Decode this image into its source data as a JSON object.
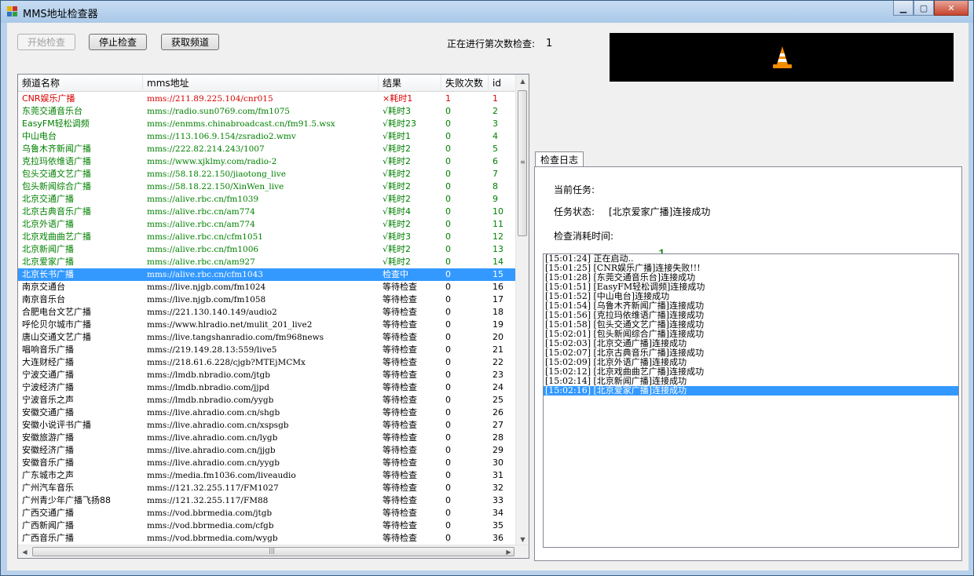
{
  "window": {
    "title": "MMS地址检查器"
  },
  "toolbar": {
    "start_label": "开始检查",
    "stop_label": "停止检查",
    "fetch_label": "获取频道",
    "count_label": "正在进行第次数检查:",
    "count_value": "1"
  },
  "colors": {
    "fail": "#d80000",
    "ok": "#008000",
    "selected": "#3399ff"
  },
  "list": {
    "columns": [
      "频道名称",
      "mms地址",
      "结果",
      "失败次数",
      "id"
    ],
    "rows": [
      {
        "name": "CNR娱乐广播",
        "url": "mms://211.89.225.104/cnr015",
        "result": "×耗时1",
        "fails": "1",
        "id": "1",
        "status": "fail"
      },
      {
        "name": "东莞交通音乐台",
        "url": "mms://radio.sun0769.com/fm1075",
        "result": "√耗时3",
        "fails": "0",
        "id": "2",
        "status": "ok"
      },
      {
        "name": "EasyFM轻松调频",
        "url": "mms://enmms.chinabroadcast.cn/fm91.5.wsx",
        "result": "√耗时23",
        "fails": "0",
        "id": "3",
        "status": "ok"
      },
      {
        "name": "中山电台",
        "url": "mms://113.106.9.154/zsradio2.wmv",
        "result": "√耗时1",
        "fails": "0",
        "id": "4",
        "status": "ok"
      },
      {
        "name": "乌鲁木齐新闻广播",
        "url": "mms://222.82.214.243/1007",
        "result": "√耗时2",
        "fails": "0",
        "id": "5",
        "status": "ok"
      },
      {
        "name": "克拉玛依维语广播",
        "url": "mms://www.xjklmy.com/radio-2",
        "result": "√耗时2",
        "fails": "0",
        "id": "6",
        "status": "ok"
      },
      {
        "name": "包头交通文艺广播",
        "url": "mms://58.18.22.150/jiaotong_live",
        "result": "√耗时2",
        "fails": "0",
        "id": "7",
        "status": "ok"
      },
      {
        "name": "包头新闻综合广播",
        "url": "mms://58.18.22.150/XinWen_live",
        "result": "√耗时2",
        "fails": "0",
        "id": "8",
        "status": "ok"
      },
      {
        "name": "北京交通广播",
        "url": "mms://alive.rbc.cn/fm1039",
        "result": "√耗时2",
        "fails": "0",
        "id": "9",
        "status": "ok"
      },
      {
        "name": "北京古典音乐广播",
        "url": "mms://alive.rbc.cn/am774",
        "result": "√耗时4",
        "fails": "0",
        "id": "10",
        "status": "ok"
      },
      {
        "name": "北京外语广播",
        "url": "mms://alive.rbc.cn/am774",
        "result": "√耗时2",
        "fails": "0",
        "id": "11",
        "status": "ok"
      },
      {
        "name": "北京戏曲曲艺广播",
        "url": "mms://alive.rbc.cn/cfm1051",
        "result": "√耗时3",
        "fails": "0",
        "id": "12",
        "status": "ok"
      },
      {
        "name": "北京新闻广播",
        "url": "mms://alive.rbc.cn/fm1006",
        "result": "√耗时2",
        "fails": "0",
        "id": "13",
        "status": "ok"
      },
      {
        "name": "北京爱家广播",
        "url": "mms://alive.rbc.cn/am927",
        "result": "√耗时2",
        "fails": "0",
        "id": "14",
        "status": "ok"
      },
      {
        "name": "北京长书广播",
        "url": "mms://alive.rbc.cn/cfm1043",
        "result": "检查中",
        "fails": "0",
        "id": "15",
        "status": "sel"
      },
      {
        "name": "南京交通台",
        "url": "mms://live.njgb.com/fm1024",
        "result": "等待检查",
        "fails": "0",
        "id": "16",
        "status": ""
      },
      {
        "name": "南京音乐台",
        "url": "mms://live.njgb.com/fm1058",
        "result": "等待检查",
        "fails": "0",
        "id": "17",
        "status": ""
      },
      {
        "name": "合肥电台文艺广播",
        "url": "mms://221.130.140.149/audio2",
        "result": "等待检查",
        "fails": "0",
        "id": "18",
        "status": ""
      },
      {
        "name": "呼伦贝尔城市广播",
        "url": "mms://www.hlradio.net/mulit_201_live2",
        "result": "等待检查",
        "fails": "0",
        "id": "19",
        "status": ""
      },
      {
        "name": "唐山交通文艺广播",
        "url": "mms://live.tangshanradio.com/fm968news",
        "result": "等待检查",
        "fails": "0",
        "id": "20",
        "status": ""
      },
      {
        "name": "唱响音乐广播",
        "url": "mms://219.149.28.13:559/live5",
        "result": "等待检查",
        "fails": "0",
        "id": "21",
        "status": ""
      },
      {
        "name": "大连财经广播",
        "url": "mms://218.61.6.228/cjgb?MTEjMCMx",
        "result": "等待检查",
        "fails": "0",
        "id": "22",
        "status": ""
      },
      {
        "name": "宁波交通广播",
        "url": "mms://lmdb.nbradio.com/jtgb",
        "result": "等待检查",
        "fails": "0",
        "id": "23",
        "status": ""
      },
      {
        "name": "宁波经济广播",
        "url": "mms://lmdb.nbradio.com/jjpd",
        "result": "等待检查",
        "fails": "0",
        "id": "24",
        "status": ""
      },
      {
        "name": "宁波音乐之声",
        "url": "mms://lmdb.nbradio.com/yygb",
        "result": "等待检查",
        "fails": "0",
        "id": "25",
        "status": ""
      },
      {
        "name": "安徽交通广播",
        "url": "mms://live.ahradio.com.cn/shgb",
        "result": "等待检查",
        "fails": "0",
        "id": "26",
        "status": ""
      },
      {
        "name": "安徽小说评书广播",
        "url": "mms://live.ahradio.com.cn/xspsgb",
        "result": "等待检查",
        "fails": "0",
        "id": "27",
        "status": ""
      },
      {
        "name": "安徽旅游广播",
        "url": "mms://live.ahradio.com.cn/lygb",
        "result": "等待检查",
        "fails": "0",
        "id": "28",
        "status": ""
      },
      {
        "name": "安徽经济广播",
        "url": "mms://live.ahradio.com.cn/jjgb",
        "result": "等待检查",
        "fails": "0",
        "id": "29",
        "status": ""
      },
      {
        "name": "安徽音乐广播",
        "url": "mms://live.ahradio.com.cn/yygb",
        "result": "等待检查",
        "fails": "0",
        "id": "30",
        "status": ""
      },
      {
        "name": "广东城市之声",
        "url": "mms://media.fm1036.com/liveaudio",
        "result": "等待检查",
        "fails": "0",
        "id": "31",
        "status": ""
      },
      {
        "name": "广州汽车音乐",
        "url": "mms://121.32.255.117/FM1027",
        "result": "等待检查",
        "fails": "0",
        "id": "32",
        "status": ""
      },
      {
        "name": "广州青少年广播飞扬88",
        "url": "mms://121.32.255.117/FM88",
        "result": "等待检查",
        "fails": "0",
        "id": "33",
        "status": ""
      },
      {
        "name": "广西交通广播",
        "url": "mms://vod.bbrmedia.com/jtgb",
        "result": "等待检查",
        "fails": "0",
        "id": "34",
        "status": ""
      },
      {
        "name": "广西新闻广播",
        "url": "mms://vod.bbrmedia.com/cfgb",
        "result": "等待检查",
        "fails": "0",
        "id": "35",
        "status": ""
      },
      {
        "name": "广西音乐广播",
        "url": "mms://vod.bbrmedia.com/wygb",
        "result": "等待检查",
        "fails": "0",
        "id": "36",
        "status": ""
      }
    ]
  },
  "log_tab": {
    "tab_label": "检查日志",
    "current_task_label": "当前任务:",
    "task_status_label": "任务状态:",
    "task_status_value": "[北京爱家广播]连接成功",
    "elapsed_label": "检查消耗时间:",
    "elapsed_value": "1",
    "lines": [
      "[15:01:24] 正在启动..",
      "[15:01:25] [CNR娱乐广播]连接失败!!!",
      "[15:01:28] [东莞交通音乐台]连接成功",
      "[15:01:51] [EasyFM轻松调频]连接成功",
      "[15:01:52] [中山电台]连接成功",
      "[15:01:54] [乌鲁木齐新闻广播]连接成功",
      "[15:01:56] [克拉玛依维语广播]连接成功",
      "[15:01:58] [包头交通文艺广播]连接成功",
      "[15:02:01] [包头新闻综合广播]连接成功",
      "[15:02:03] [北京交通广播]连接成功",
      "[15:02:07] [北京古典音乐广播]连接成功",
      "[15:02:09] [北京外语广播]连接成功",
      "[15:02:12] [北京戏曲曲艺广播]连接成功",
      "[15:02:14] [北京新闻广播]连接成功",
      "[15:02:16] [北京爱家广播]连接成功"
    ],
    "selected_index": 14
  },
  "icons": {
    "app": "app-icon",
    "media": "vlc-cone-icon",
    "minimize": "minimize-icon",
    "maximize": "maximize-icon",
    "close": "close-icon"
  }
}
